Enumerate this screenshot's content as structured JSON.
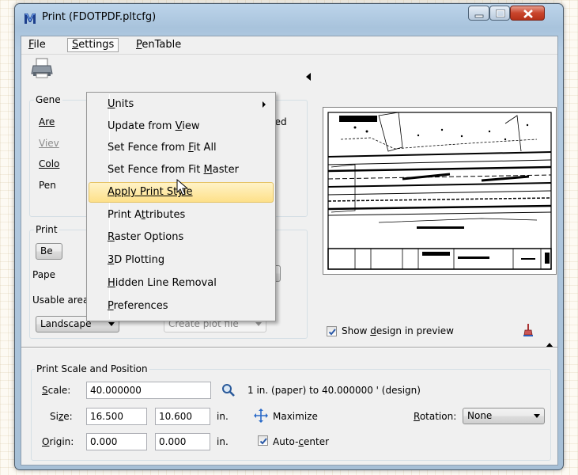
{
  "window": {
    "title": "Print  (FDOTPDF.pltcfg)"
  },
  "menubar": [
    {
      "label": "File",
      "accel": "F",
      "rest": "ile"
    },
    {
      "label": "Settings",
      "accel": "S",
      "rest": "ettings"
    },
    {
      "label": "PenTable",
      "accel": "P",
      "rest": "enTable"
    }
  ],
  "settings_menu": {
    "items": [
      {
        "pre": "",
        "accel": "U",
        "post": "nits",
        "submenu": true
      },
      {
        "pre": "Update from ",
        "accel": "V",
        "post": "iew"
      },
      {
        "pre": "Set Fence from ",
        "accel": "F",
        "post": "it All"
      },
      {
        "pre": "Set Fence from Fit ",
        "accel": "M",
        "post": "aster"
      },
      {
        "pre": "",
        "accel": "A",
        "post": "pply Print Style",
        "highlighted": true
      },
      {
        "pre": "Print A",
        "accel": "t",
        "post": "tributes"
      },
      {
        "pre": "",
        "accel": "R",
        "post": "aster Options"
      },
      {
        "pre": "",
        "accel": "3",
        "post": "D Plotting"
      },
      {
        "pre": "",
        "accel": "H",
        "post": "idden Line Removal"
      },
      {
        "pre": "",
        "accel": "P",
        "post": "references"
      }
    ]
  },
  "general_group": {
    "label_partial": "Gene",
    "area_partial": "Are",
    "view_partial": "Viev",
    "color_partial": "Colo",
    "pen_partial": "Pen",
    "rasterized_partial": "ized"
  },
  "printer_group": {
    "label_partial": "Print",
    "button_partial": "Be",
    "paper_partial": "Pape",
    "usable_area": "Usable area:  16.5 x 10.6 in.",
    "orientation": "Landscape",
    "plot_file": "Create plot file"
  },
  "preview": {
    "show_design_label_pre": "Show ",
    "show_design_accel": "d",
    "show_design_label_post": "esign in preview",
    "show_design_checked": true
  },
  "scale_group": {
    "label": "Print Scale and Position",
    "scale_label_accel": "S",
    "scale_label_rest": "cale:",
    "scale_value": "40.000000",
    "scale_text": "1 in. (paper) to 40.000000 ' (design)",
    "size_label_pre": "Si",
    "size_label_accel": "z",
    "size_label_post": "e:",
    "size_w": "16.500",
    "size_h": "10.600",
    "size_unit": "in.",
    "maximize": "Maximize",
    "rotation_label_accel": "R",
    "rotation_label_rest": "otation:",
    "rotation_value": "None",
    "origin_label_accel": "O",
    "origin_label_rest": "rigin:",
    "origin_x": "0.000",
    "origin_y": "0.000",
    "origin_unit": "in.",
    "autocenter_pre": "Auto-",
    "autocenter_accel": "c",
    "autocenter_post": "enter",
    "autocenter_checked": true
  },
  "colors": {
    "highlight_top": "#fff3c7",
    "highlight_bottom": "#fde089",
    "title_bar": "#b6cde3",
    "close_button": "#c9452c"
  }
}
